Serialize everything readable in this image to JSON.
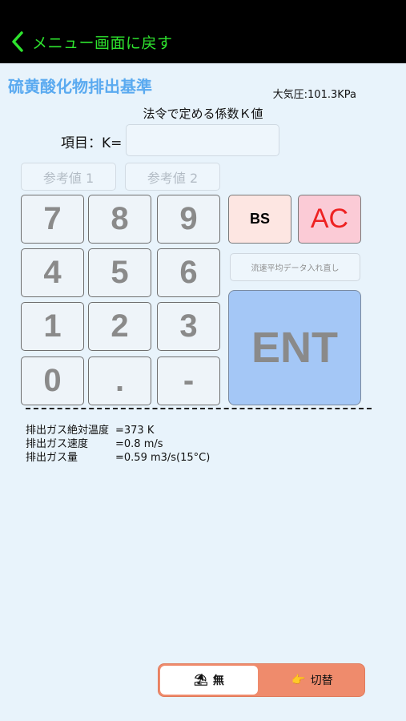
{
  "nav": {
    "back_label": "メニュー画面に戻す"
  },
  "page": {
    "title": "硫黄酸化物排出基準",
    "pressure": "大気圧:101.3KPa",
    "subtitle": "法令で定める係数Ｋ値",
    "item_label": "項目：K=",
    "k_value": ""
  },
  "refs": [
    "参考値 1",
    "参考値 2"
  ],
  "keypad": {
    "keys": [
      "7",
      "8",
      "9",
      "4",
      "5",
      "6",
      "1",
      "2",
      "3",
      "0",
      ".",
      "-"
    ],
    "bs": "BS",
    "ac": "AC",
    "reenter": "流速平均データ入れ直し",
    "ent": "ENT"
  },
  "info": [
    {
      "label": "排出ガス絶対温度",
      "value": "=373 K"
    },
    {
      "label": "排出ガス速度",
      "value": "=0.8 m/s"
    },
    {
      "label": "排出ガス量",
      "value": "=0.59 m3/s(15°C)"
    }
  ],
  "toggle": {
    "left_icon": "⛱",
    "left_label": "無",
    "right_icon": "👉",
    "right_label": "切替"
  },
  "colors": {
    "nav_bg": "#000000",
    "nav_text": "#2ee32e",
    "title": "#5aaaf0",
    "ent_bg": "#a4c7f6",
    "ac_bg": "#fbcbd6",
    "ac_text": "#ee2222",
    "bs_bg": "#fde6e2",
    "toggle_bg": "#ef8b6c"
  }
}
